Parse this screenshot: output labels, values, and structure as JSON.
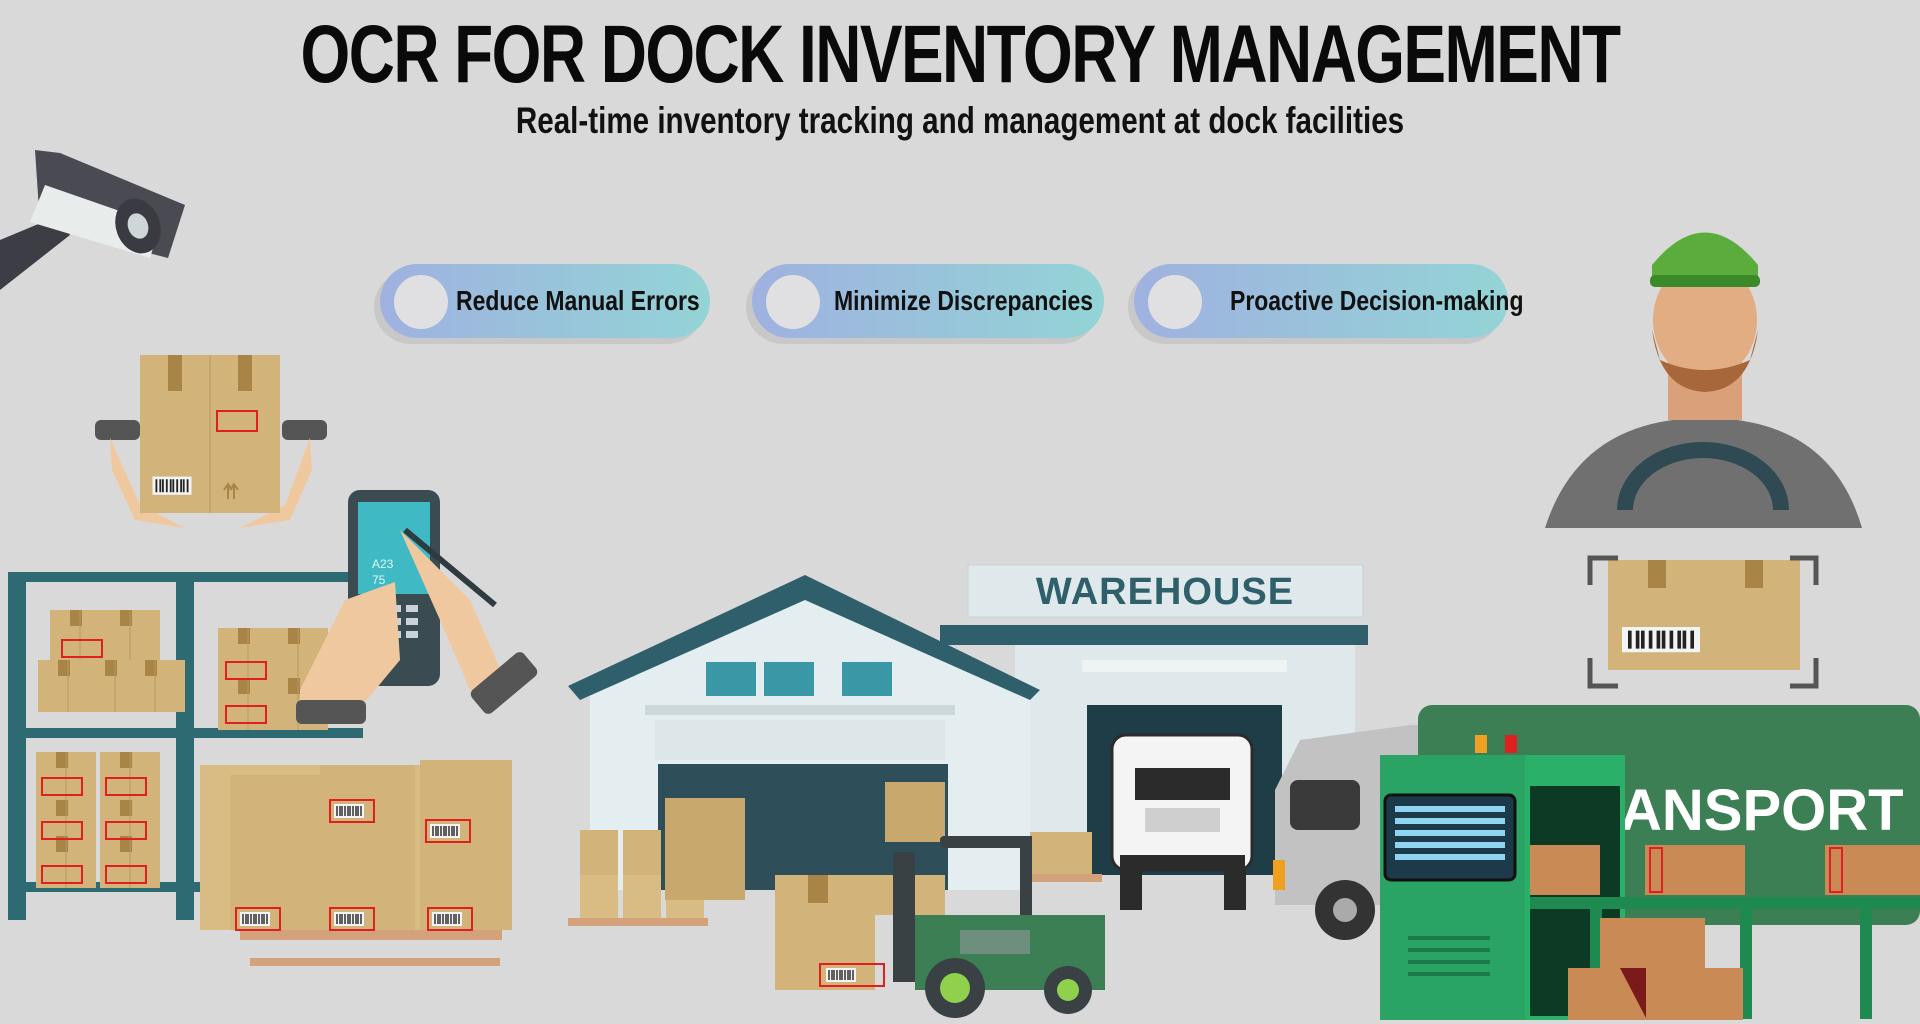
{
  "header": {
    "title": "OCR FOR DOCK INVENTORY MANAGEMENT",
    "subtitle": "Real-time inventory tracking and management at dock facilities"
  },
  "benefits": [
    {
      "label": "Reduce Manual Errors"
    },
    {
      "label": "Minimize Discrepancies"
    },
    {
      "label": "Proactive Decision-making"
    }
  ],
  "scene": {
    "warehouse_sign": "WAREHOUSE",
    "transport_sign": "ANSPORT",
    "scanner_screen": {
      "line1": "A23",
      "line2": "75"
    }
  },
  "colors": {
    "background": "#d9d9d9",
    "box": "#d2b47a",
    "box_tape": "#a88446",
    "shelf": "#2e6a72",
    "warehouse_roof": "#2f5f6b",
    "transport_green": "#3d7f54",
    "machine_green": "#2bb06a",
    "label_outline": "#e02020"
  },
  "icons": {
    "camera": "security-camera-icon",
    "worker": "worker-icon",
    "forklift": "forklift-icon",
    "truck": "truck-icon"
  }
}
